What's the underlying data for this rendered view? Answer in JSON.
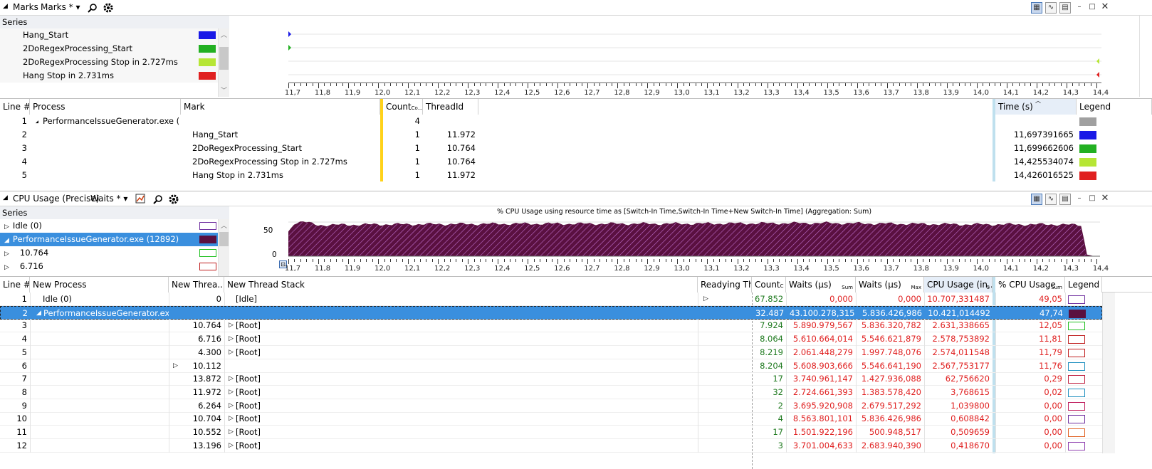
{
  "marks_panel": {
    "title": "Marks",
    "preset": "Marks *",
    "series_header": "Series",
    "series": [
      {
        "label": "Hang_Start",
        "color": "#1a1ae6"
      },
      {
        "label": "2DoRegexProcessing_Start",
        "color": "#22b022"
      },
      {
        "label": "2DoRegexProcessing Stop in 2.727ms",
        "color": "#b6e635"
      },
      {
        "label": "Hang Stop in 2.731ms",
        "color": "#e02020"
      }
    ],
    "axis_ticks": [
      "11,7",
      "11,8",
      "11,9",
      "12,0",
      "12,1",
      "12,2",
      "12,3",
      "12,4",
      "12,5",
      "12,6",
      "12,7",
      "12,8",
      "12,9",
      "13,0",
      "13,1",
      "13,2",
      "13,3",
      "13,4",
      "13,5",
      "13,6",
      "13,7",
      "13,8",
      "13,9",
      "14,0",
      "14,1",
      "14,2",
      "14,3",
      "14,4"
    ],
    "columns": {
      "line": "Line #",
      "process": "Process",
      "mark": "Mark",
      "count": "Count",
      "count_sub": "Co...",
      "threadid": "ThreadId",
      "time": "Time (s)",
      "legend": "Legend"
    },
    "rows": [
      {
        "line": "1",
        "process": "PerformanceIssueGenerator.exe (12...",
        "mark": "",
        "count": "4",
        "threadid": "",
        "time": "",
        "legend": "#a0a0a0"
      },
      {
        "line": "2",
        "process": "",
        "mark": "Hang_Start",
        "count": "1",
        "threadid": "11.972",
        "time": "11,697391665",
        "legend": "#1a1ae6"
      },
      {
        "line": "3",
        "process": "",
        "mark": "2DoRegexProcessing_Start",
        "count": "1",
        "threadid": "10.764",
        "time": "11,699662606",
        "legend": "#22b022"
      },
      {
        "line": "4",
        "process": "",
        "mark": "2DoRegexProcessing Stop in 2.727ms",
        "count": "1",
        "threadid": "10.764",
        "time": "14,425534074",
        "legend": "#b6e635"
      },
      {
        "line": "5",
        "process": "",
        "mark": "Hang Stop in 2.731ms",
        "count": "1",
        "threadid": "11.972",
        "time": "14,426016525",
        "legend": "#e02020"
      }
    ]
  },
  "cpu_panel": {
    "title": "CPU Usage (Precise)",
    "preset": "Waits *",
    "series_header": "Series",
    "series": [
      {
        "label": "Idle (0)",
        "expander": "▷",
        "color": "#7030a0"
      },
      {
        "label": "PerformanceIssueGenerator.exe (12892)",
        "expander": "◢",
        "color": "#5a1040"
      },
      {
        "label": "10.764",
        "expander": "▷",
        "color": "#22c022"
      },
      {
        "label": "6.716",
        "expander": "▷",
        "color": "#c02020"
      }
    ],
    "chart_title": "% CPU Usage using resource time as [Switch-In Time,Switch-In Time+New Switch-In Time] (Aggregation: Sum)",
    "y_ticks": [
      "50",
      "0"
    ],
    "axis_ticks": [
      "11,7",
      "11,8",
      "11,9",
      "12,0",
      "12,1",
      "12,2",
      "12,3",
      "12,4",
      "12,5",
      "12,6",
      "12,7",
      "12,8",
      "12,9",
      "13,0",
      "13,1",
      "13,2",
      "13,3",
      "13,4",
      "13,5",
      "13,6",
      "13,7",
      "13,8",
      "13,9",
      "14,0",
      "14,1",
      "14,2",
      "14,3",
      "14,4"
    ],
    "columns": {
      "line": "Line #",
      "process": "New Process",
      "thread": "New Threa...",
      "stack": "New Thread Stack",
      "readying": "Readying Thre",
      "count": "Count",
      "count_sub": "C",
      "waits_sum": "Waits (µs)",
      "waits_sum_sub": "Sum",
      "waits_max": "Waits (µs)",
      "waits_max_sub": "Max",
      "cpu": "CPU Usage (in...",
      "cpu_sub": "S",
      "pct": "% CPU Usage",
      "pct_sub": "Sum",
      "legend": "Legend"
    },
    "rows": [
      {
        "line": "1",
        "process": "Idle (0)",
        "thread": "0",
        "stack": "[Idle]",
        "stack_exp": "",
        "readying": "▷",
        "count": "67.852",
        "waits_sum": "0,000",
        "waits_max": "0,000",
        "cpu": "10.707,331487",
        "pct": "49,05",
        "legend": "#7030a0",
        "fill": "#fff"
      },
      {
        "line": "2",
        "process": "PerformanceIssueGenerator.exe...",
        "thread": "",
        "stack": "",
        "stack_exp": "",
        "readying": "",
        "count": "32.487",
        "waits_sum": "43.100.278,315",
        "waits_max": "5.836.426,986",
        "cpu": "10.421,014492",
        "pct": "47,74",
        "legend": "#5a1040",
        "fill": "#5a1040"
      },
      {
        "line": "3",
        "process": "",
        "thread": "10.764",
        "stack": "[Root]",
        "stack_exp": "▷",
        "readying": "",
        "count": "7.924",
        "waits_sum": "5.890.979,567",
        "waits_max": "5.836.320,782",
        "cpu": "2.631,338665",
        "pct": "12,05",
        "legend": "#22c022",
        "fill": "#fff"
      },
      {
        "line": "4",
        "process": "",
        "thread": "6.716",
        "stack": "[Root]",
        "stack_exp": "▷",
        "readying": "",
        "count": "8.064",
        "waits_sum": "5.610.664,014",
        "waits_max": "5.546.621,879",
        "cpu": "2.578,753892",
        "pct": "11,81",
        "legend": "#c02020",
        "fill": "#fff"
      },
      {
        "line": "5",
        "process": "",
        "thread": "4.300",
        "stack": "[Root]",
        "stack_exp": "▷",
        "readying": "",
        "count": "8.219",
        "waits_sum": "2.061.448,279",
        "waits_max": "1.997.748,076",
        "cpu": "2.574,011548",
        "pct": "11,79",
        "legend": "#c02020",
        "fill": "#fff"
      },
      {
        "line": "6",
        "process": "",
        "thread": "10.112",
        "stack": "",
        "stack_exp": "",
        "thread_exp": "▷",
        "readying": "",
        "count": "8.204",
        "waits_sum": "5.608.903,666",
        "waits_max": "5.546.641,190",
        "cpu": "2.567,753177",
        "pct": "11,76",
        "legend": "#2090c0",
        "fill": "#fff"
      },
      {
        "line": "7",
        "process": "",
        "thread": "13.872",
        "stack": "[Root]",
        "stack_exp": "▷",
        "readying": "",
        "count": "17",
        "waits_sum": "3.740.961,147",
        "waits_max": "1.427.936,088",
        "cpu": "62,756620",
        "pct": "0,29",
        "legend": "#c02040",
        "fill": "#fff"
      },
      {
        "line": "8",
        "process": "",
        "thread": "11.972",
        "stack": "[Root]",
        "stack_exp": "▷",
        "readying": "",
        "count": "32",
        "waits_sum": "2.724.661,393",
        "waits_max": "1.383.578,420",
        "cpu": "3,768615",
        "pct": "0,02",
        "legend": "#2090c0",
        "fill": "#fff"
      },
      {
        "line": "9",
        "process": "",
        "thread": "6.264",
        "stack": "[Root]",
        "stack_exp": "▷",
        "readying": "",
        "count": "2",
        "waits_sum": "3.695.920,908",
        "waits_max": "2.679.517,292",
        "cpu": "1,039800",
        "pct": "0,00",
        "legend": "#c02060",
        "fill": "#fff"
      },
      {
        "line": "10",
        "process": "",
        "thread": "10.704",
        "stack": "[Root]",
        "stack_exp": "▷",
        "readying": "",
        "count": "4",
        "waits_sum": "8.563.801,101",
        "waits_max": "5.836.426,986",
        "cpu": "0,608842",
        "pct": "0,00",
        "legend": "#7030a0",
        "fill": "#fff"
      },
      {
        "line": "11",
        "process": "",
        "thread": "10.552",
        "stack": "[Root]",
        "stack_exp": "▷",
        "readying": "",
        "count": "17",
        "waits_sum": "1.501.922,196",
        "waits_max": "500.948,517",
        "cpu": "0,509659",
        "pct": "0,00",
        "legend": "#e06020",
        "fill": "#fff"
      },
      {
        "line": "12",
        "process": "",
        "thread": "13.196",
        "stack": "[Root]",
        "stack_exp": "▷",
        "readying": "",
        "count": "3",
        "waits_sum": "3.701.004,633",
        "waits_max": "2.683.940,390",
        "cpu": "0,418670",
        "pct": "0,00",
        "legend": "#9040b0",
        "fill": "#fff"
      }
    ]
  },
  "chart_data": {
    "type": "area",
    "title": "% CPU Usage using resource time as [Switch-In Time,Switch-In Time+New Switch-In Time] (Aggregation: Sum)",
    "xlim": [
      11.7,
      14.4
    ],
    "ylim": [
      0,
      50
    ],
    "series": [
      {
        "name": "PerformanceIssueGenerator.exe (12892)",
        "color": "#5a1040",
        "x": [
          11.7,
          11.72,
          11.75,
          11.8,
          12.0,
          12.5,
          13.0,
          13.5,
          14.0,
          14.3,
          14.38,
          14.4,
          14.42
        ],
        "values": [
          35,
          48,
          50,
          45,
          46,
          47,
          47,
          48,
          46,
          46,
          45,
          2,
          0
        ]
      }
    ]
  }
}
